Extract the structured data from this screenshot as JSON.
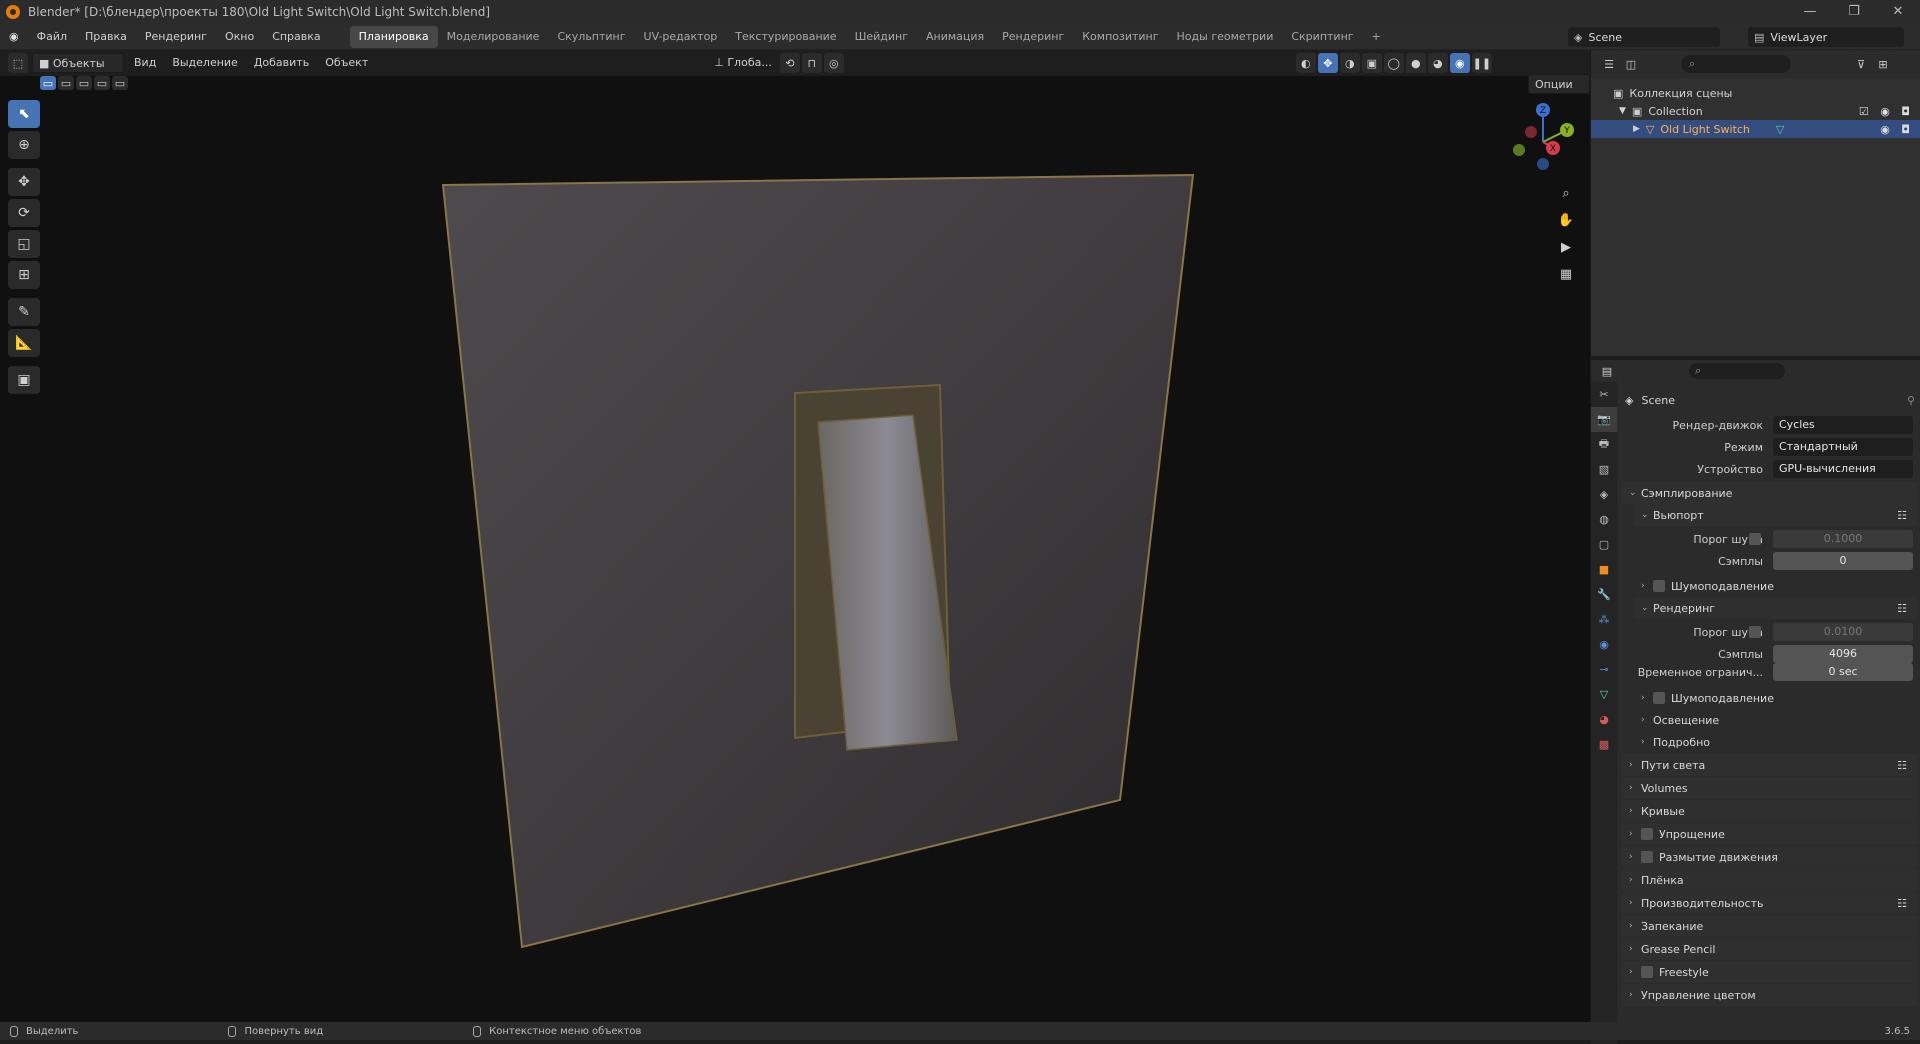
{
  "app": {
    "title": "Blender* [D:\\блендер\\проекты 180\\Old Light Switch\\Old Light Switch.blend]",
    "window_controls": [
      "—",
      "❐",
      "✕"
    ]
  },
  "menu": {
    "items": [
      "Файл",
      "Правка",
      "Рендеринг",
      "Окно",
      "Справка"
    ],
    "workspaces": [
      "Планировка",
      "Моделирование",
      "Скульптинг",
      "UV-редактор",
      "Текстурирование",
      "Шейдинг",
      "Анимация",
      "Рендеринг",
      "Композитинг",
      "Ноды геометрии",
      "Скриптинг"
    ],
    "active_workspace": "Планировка",
    "add_tab": "+",
    "scene": "Scene",
    "view_layer": "ViewLayer"
  },
  "viewport": {
    "mode": "Объекты",
    "menus": [
      "Вид",
      "Выделение",
      "Добавить",
      "Объект"
    ],
    "transform": "Глоба...",
    "options": "Опции",
    "axes": {
      "z": "Z",
      "y": "Y",
      "x": "X"
    }
  },
  "toolbar": {
    "tools": [
      "select-tool",
      "cursor-tool",
      "move-tool",
      "rotate-tool",
      "scale-tool",
      "transform-tool",
      "annotate-tool",
      "measure-tool",
      "add-cube-tool"
    ]
  },
  "outliner": {
    "root": "Коллекция сцены",
    "collection": "Collection",
    "object": "Old Light Switch"
  },
  "properties": {
    "scene": "Scene",
    "render_engine_label": "Рендер-движок",
    "render_engine": "Cycles",
    "mode_label": "Режим",
    "mode": "Стандартный",
    "device_label": "Устройство",
    "device": "GPU-вычисления",
    "sampling": "Сэмплирование",
    "viewport": "Вьюпорт",
    "noise_threshold_label": "Порог шума",
    "viewport_noise_threshold": "0.1000",
    "samples_label": "Сэмплы",
    "viewport_samples": "0",
    "denoise": "Шумоподавление",
    "render": "Рендеринг",
    "render_noise_threshold": "0.0100",
    "render_samples": "4096",
    "time_limit_label": "Временное огранич...",
    "time_limit": "0 sec",
    "lights": "Освещение",
    "advanced": "Подробно",
    "sections": [
      "Пути света",
      "Volumes",
      "Кривые",
      "Упрощение",
      "Размытие движения",
      "Плёнка",
      "Производительность",
      "Запекание",
      "Grease Pencil",
      "Freestyle",
      "Управление цветом"
    ]
  },
  "statusbar": {
    "select": "Выделить",
    "rotate_view": "Повернуть вид",
    "context_menu": "Контекстное меню объектов",
    "version": "3.6.5"
  }
}
